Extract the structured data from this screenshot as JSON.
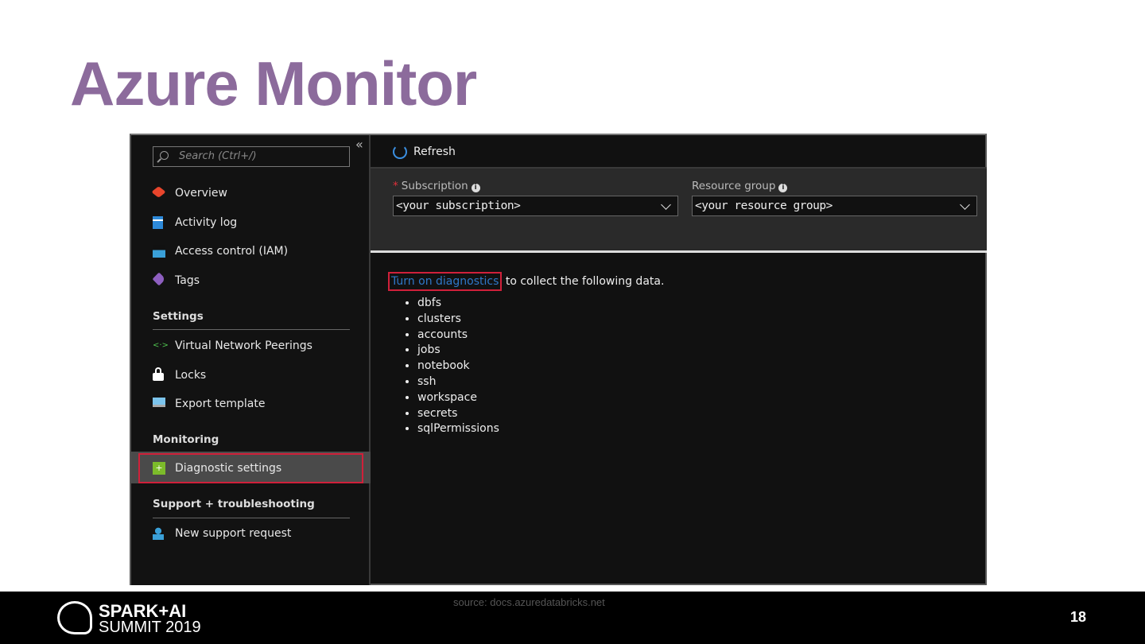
{
  "slide": {
    "title": "Azure Monitor",
    "source": "source: docs.azuredatabricks.net",
    "page_number": "18",
    "logo_line1": "SPARK+AI",
    "logo_line2": "SUMMIT 2019"
  },
  "sidebar": {
    "search_placeholder": "Search (Ctrl+/)",
    "collapse": "«",
    "items": [
      {
        "label": "Overview",
        "icon": "overview-icon",
        "color": "#e8452c"
      },
      {
        "label": "Activity log",
        "icon": "activity-log-icon",
        "color": "#2d89d8"
      },
      {
        "label": "Access control (IAM)",
        "icon": "iam-icon",
        "color": "#3aa0d8"
      },
      {
        "label": "Tags",
        "icon": "tag-icon",
        "color": "#8e5fc0"
      }
    ],
    "sections": [
      {
        "title": "Settings",
        "items": [
          {
            "label": "Virtual Network Peerings",
            "icon": "peering-icon"
          },
          {
            "label": "Locks",
            "icon": "lock-icon"
          },
          {
            "label": "Export template",
            "icon": "export-template-icon"
          }
        ]
      },
      {
        "title": "Monitoring",
        "items": [
          {
            "label": "Diagnostic settings",
            "icon": "diagnostic-icon",
            "selected": true
          }
        ]
      },
      {
        "title": "Support + troubleshooting",
        "items": [
          {
            "label": "New support request",
            "icon": "support-icon"
          }
        ]
      }
    ]
  },
  "toolbar": {
    "refresh": "Refresh"
  },
  "filters": {
    "subscription_label": "Subscription",
    "required": "*",
    "subscription_value": "<your subscription>",
    "resource_group_label": "Resource group",
    "resource_group_value": "<your resource group>",
    "info": "i"
  },
  "main": {
    "link": "Turn on diagnostics",
    "message": " to collect the following data.",
    "logs": [
      "dbfs",
      "clusters",
      "accounts",
      "jobs",
      "notebook",
      "ssh",
      "workspace",
      "secrets",
      "sqlPermissions"
    ]
  }
}
